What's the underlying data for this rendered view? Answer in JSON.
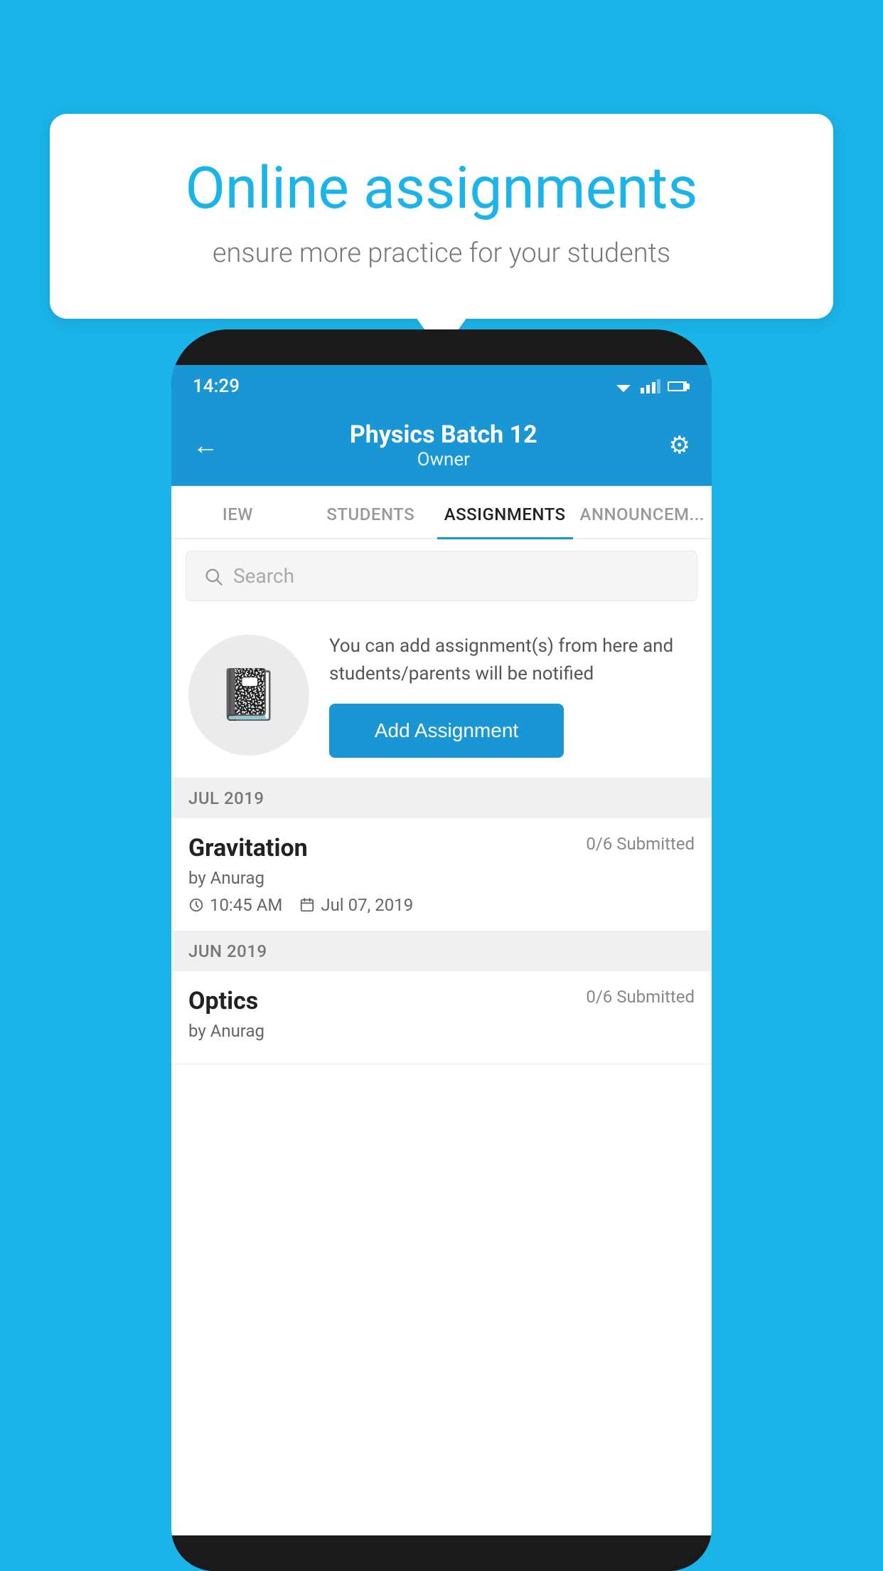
{
  "background": {
    "color": "#1ab4e8"
  },
  "speech_bubble": {
    "title": "Online assignments",
    "subtitle": "ensure more practice for your students"
  },
  "status_bar": {
    "time": "14:29"
  },
  "app_header": {
    "title": "Physics Batch 12",
    "subtitle": "Owner",
    "back_label": "←",
    "gear_label": "⚙"
  },
  "tabs": [
    {
      "label": "IEW",
      "active": false
    },
    {
      "label": "STUDENTS",
      "active": false
    },
    {
      "label": "ASSIGNMENTS",
      "active": true
    },
    {
      "label": "ANNOUNCEM...",
      "active": false
    }
  ],
  "search": {
    "placeholder": "Search"
  },
  "add_assignment": {
    "description": "You can add assignment(s) from here and students/parents will be notified",
    "button_label": "Add Assignment"
  },
  "sections": [
    {
      "month": "JUL 2019",
      "items": [
        {
          "name": "Gravitation",
          "submitted": "0/6 Submitted",
          "by": "by Anurag",
          "time": "10:45 AM",
          "date": "Jul 07, 2019"
        }
      ]
    },
    {
      "month": "JUN 2019",
      "items": [
        {
          "name": "Optics",
          "submitted": "0/6 Submitted",
          "by": "by Anurag",
          "time": "",
          "date": ""
        }
      ]
    }
  ]
}
